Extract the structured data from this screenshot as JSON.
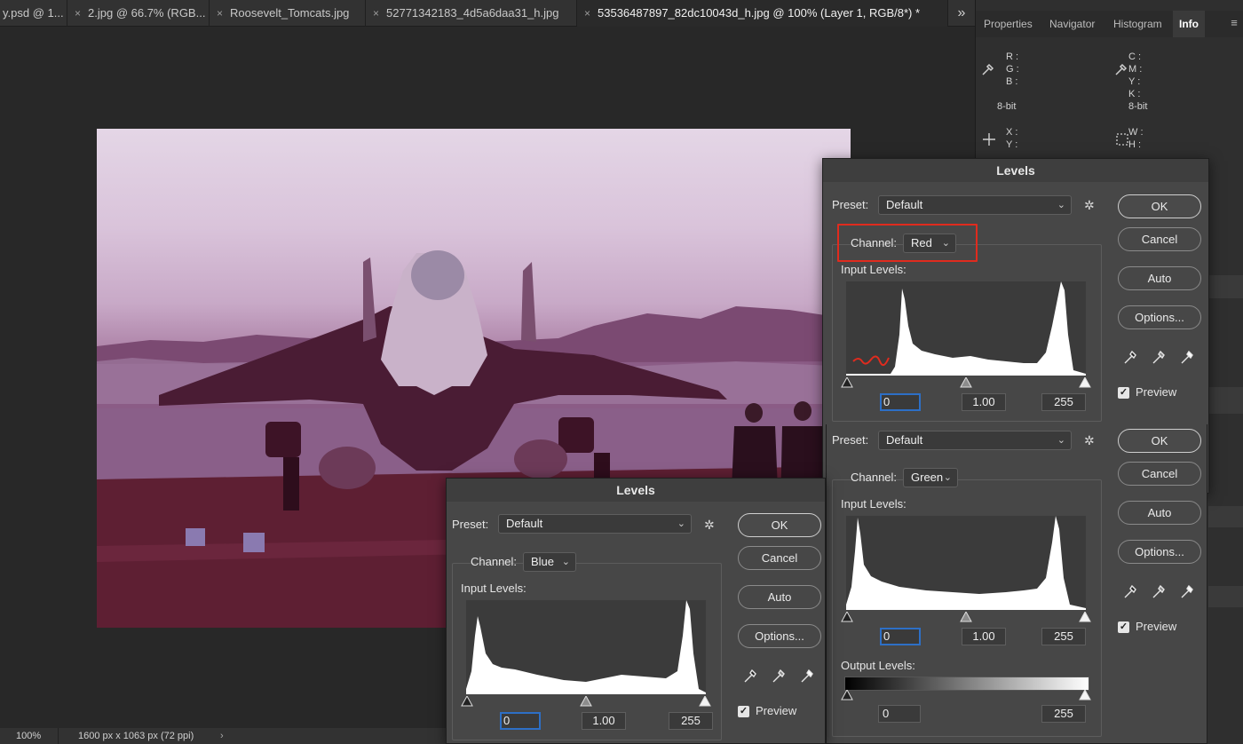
{
  "tabs": [
    {
      "label": "y.psd @ 1...",
      "close": "×"
    },
    {
      "label": "2.jpg @ 66.7% (RGB...",
      "close": "×"
    },
    {
      "label": "Roosevelt_Tomcats.jpg",
      "close": "×"
    },
    {
      "label": "52771342183_4d5a6daa31_h.jpg",
      "close": "×"
    },
    {
      "label": "53536487897_82dc10043d_h.jpg @ 100% (Layer 1, RGB/8*) *",
      "close": "×"
    }
  ],
  "tab_overflow": "»",
  "status": {
    "zoom": "100%",
    "doc_size": "1600 px x 1063 px (72 ppi)",
    "arrow": "›"
  },
  "panel": {
    "tabs": [
      "Properties",
      "Navigator",
      "Histogram",
      "Info"
    ],
    "active_tab": "Info",
    "menu_icon": "≡",
    "info": {
      "rgb": [
        "R :",
        "G :",
        "B :"
      ],
      "cmyk": [
        "C :",
        "M :",
        "Y :",
        "K :"
      ],
      "bit_left": "8-bit",
      "bit_right": "8-bit",
      "xy": [
        "X :",
        "Y :"
      ],
      "wh": [
        "W :",
        "H :"
      ]
    }
  },
  "dialog_red": {
    "title": "Levels",
    "preset_label": "Preset:",
    "preset_value": "Default",
    "channel_label": "Channel:",
    "channel_value": "Red",
    "input_levels_label": "Input Levels:",
    "input_black": "0",
    "input_gamma": "1.00",
    "input_white": "255",
    "buttons": {
      "ok": "OK",
      "cancel": "Cancel",
      "auto": "Auto",
      "options": "Options..."
    },
    "preview_label": "Preview",
    "preview_checked": true,
    "highlight_color": "#e02b1e"
  },
  "dialog_green": {
    "preset_label": "Preset:",
    "preset_value": "Default",
    "channel_label": "Channel:",
    "channel_value": "Green",
    "input_levels_label": "Input Levels:",
    "input_black": "0",
    "input_gamma": "1.00",
    "input_white": "255",
    "output_levels_label": "Output Levels:",
    "output_black": "0",
    "output_white": "255",
    "buttons": {
      "ok": "OK",
      "cancel": "Cancel",
      "auto": "Auto",
      "options": "Options..."
    },
    "preview_label": "Preview",
    "preview_checked": true
  },
  "dialog_blue": {
    "title": "Levels",
    "preset_label": "Preset:",
    "preset_value": "Default",
    "channel_label": "Channel:",
    "channel_value": "Blue",
    "input_levels_label": "Input Levels:",
    "input_black": "0",
    "input_gamma": "1.00",
    "input_white": "255",
    "buttons": {
      "ok": "OK",
      "cancel": "Cancel",
      "auto": "Auto",
      "options": "Options..."
    },
    "preview_label": "Preview",
    "preview_checked": true
  },
  "icons": {
    "chevron": "⌄",
    "gear": "✲",
    "check": "✓"
  }
}
